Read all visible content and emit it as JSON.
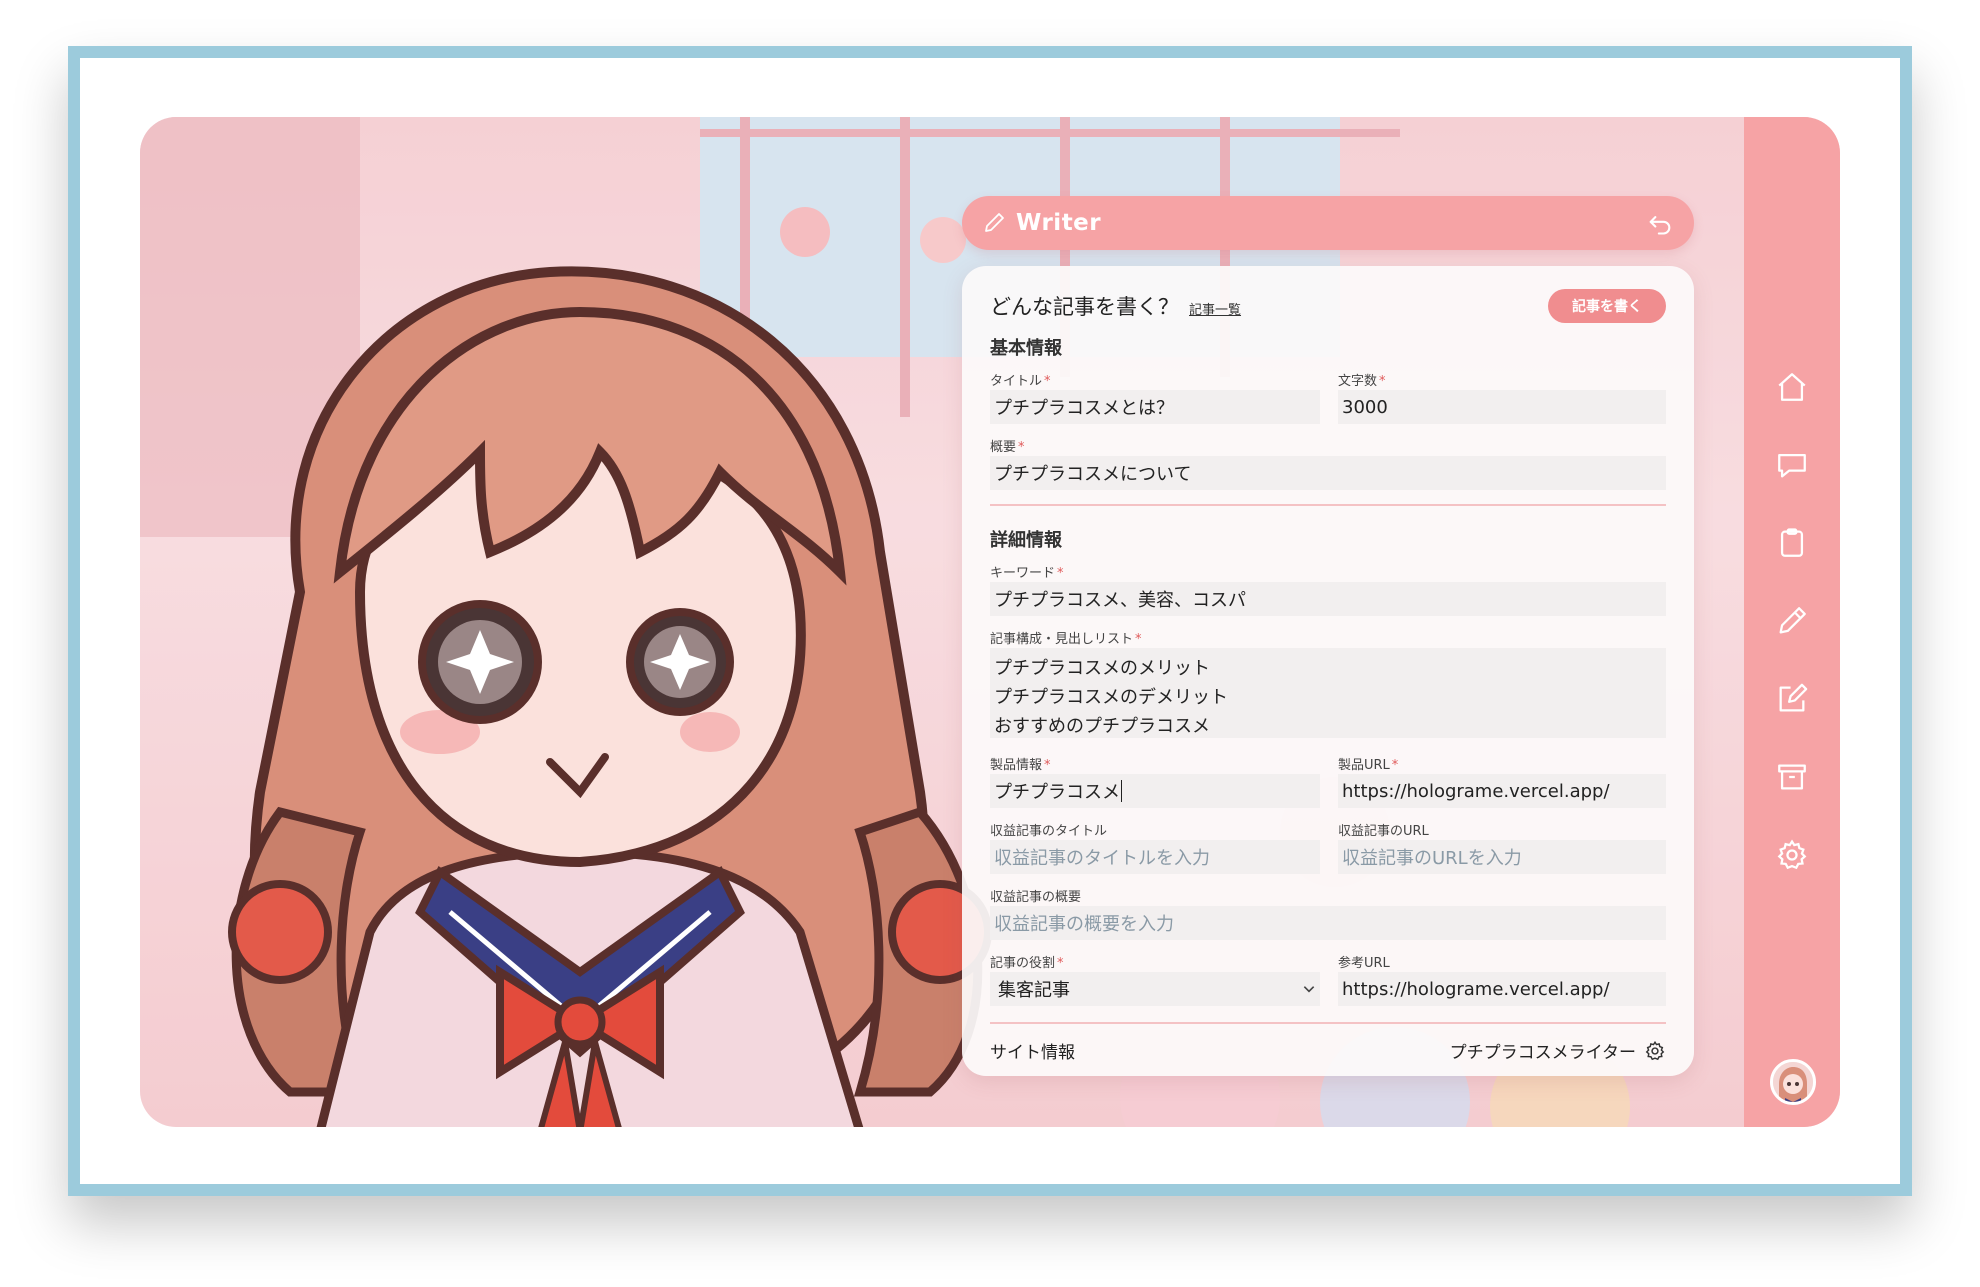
{
  "header": {
    "title": "Writer"
  },
  "panel": {
    "heading": "どんな記事を書く？",
    "list_link": "記事一覧",
    "write_button": "記事を書く",
    "basic_section": "基本情報",
    "detail_section": "詳細情報",
    "fields": {
      "title": {
        "label": "タイトル",
        "value": "プチプラコスメとは？"
      },
      "word_count": {
        "label": "文字数",
        "value": "3000"
      },
      "summary": {
        "label": "概要",
        "value": "プチプラコスメについて"
      },
      "keywords": {
        "label": "キーワード",
        "value": "プチプラコスメ、美容、コスパ"
      },
      "structure": {
        "label": "記事構成・見出しリスト",
        "lines": [
          "プチプラコスメのメリット",
          "プチプラコスメのデメリット",
          "おすすめのプチプラコスメ"
        ]
      },
      "product_info": {
        "label": "製品情報",
        "value": "プチプラコスメ"
      },
      "product_url": {
        "label": "製品URL",
        "value": "https://holograme.vercel.app/"
      },
      "revenue_title": {
        "label": "収益記事のタイトル",
        "placeholder": "収益記事のタイトルを入力"
      },
      "revenue_url": {
        "label": "収益記事のURL",
        "placeholder": "収益記事のURLを入力"
      },
      "revenue_summary": {
        "label": "収益記事の概要",
        "placeholder": "収益記事の概要を入力"
      },
      "role": {
        "label": "記事の役割",
        "value": "集客記事"
      },
      "reference_url": {
        "label": "参考URL",
        "value": "https://holograme.vercel.app/"
      }
    },
    "required_mark": "*",
    "footer": {
      "site_info": "サイト情報",
      "site_name": "プチプラコスメライター"
    }
  },
  "sidebar": {
    "icons": [
      "home-icon",
      "chat-icon",
      "clipboard-icon",
      "pencil-icon",
      "edit-icon",
      "archive-icon",
      "settings-icon"
    ]
  },
  "colors": {
    "accent": "#f6a3a5",
    "button": "#f08d8f",
    "frame": "#9ccbdc",
    "required": "#e05a5a"
  }
}
